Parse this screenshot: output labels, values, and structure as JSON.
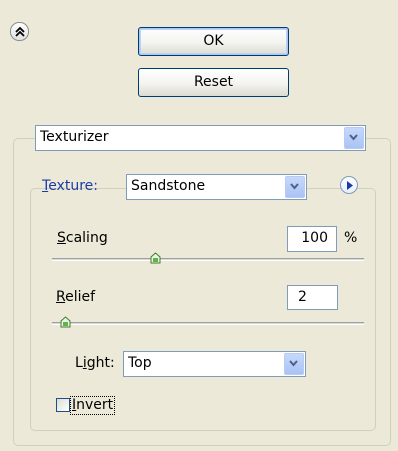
{
  "buttons": {
    "ok": "OK",
    "reset": "Reset"
  },
  "filter": {
    "selected": "Texturizer"
  },
  "texture": {
    "label": "Texture:",
    "label_accel": "T",
    "label_rest": "exture:",
    "selected": "Sandstone"
  },
  "scaling": {
    "label_accel": "S",
    "label_rest": "caling",
    "value": "100",
    "unit": "%",
    "slider_fraction": 0.33
  },
  "relief": {
    "label_accel": "R",
    "label_rest": "elief",
    "value": "2",
    "slider_fraction": 0.04
  },
  "light": {
    "label_pre": "L",
    "label_accel": "i",
    "label_rest": "ght:",
    "selected": "Top"
  },
  "invert": {
    "label_accel": "I",
    "label_rest": "nvert",
    "checked": false
  },
  "colors": {
    "background": "#ece9d8",
    "button_border": "#003c74",
    "field_border": "#7f9db9",
    "dropdown_arrow": "#4d6185",
    "label_blue": "#1c3ba6"
  },
  "icons": {
    "collapse": "double-chevron-up-icon",
    "dropdown": "chevron-down-icon",
    "menu": "triangle-right-icon",
    "thumb": "slider-thumb-icon"
  }
}
